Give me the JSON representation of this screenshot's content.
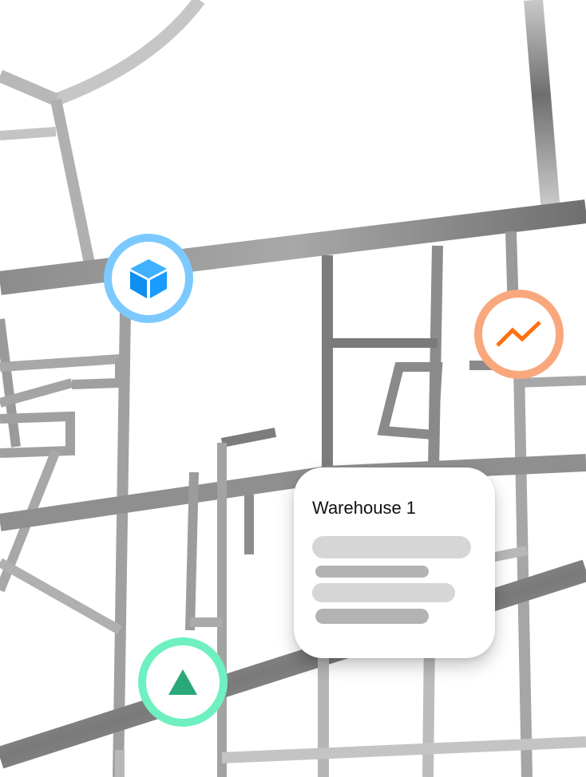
{
  "map": {
    "road_color": "#c8c8c8",
    "road_dark_color": "#8a8a8a"
  },
  "pins": [
    {
      "name": "warehouse-pin",
      "icon": "box-icon",
      "ring_color": "#7cc9ff",
      "icon_color": "#1a9cff"
    },
    {
      "name": "trend-pin",
      "icon": "trend-up-icon",
      "ring_color": "#f9a77d",
      "icon_color": "#ff6f0f"
    },
    {
      "name": "location-pin",
      "icon": "triangle-icon",
      "ring_color": "#6ff0c0",
      "icon_color": "#2ba87a"
    }
  ],
  "popup": {
    "title": "Warehouse 1"
  }
}
